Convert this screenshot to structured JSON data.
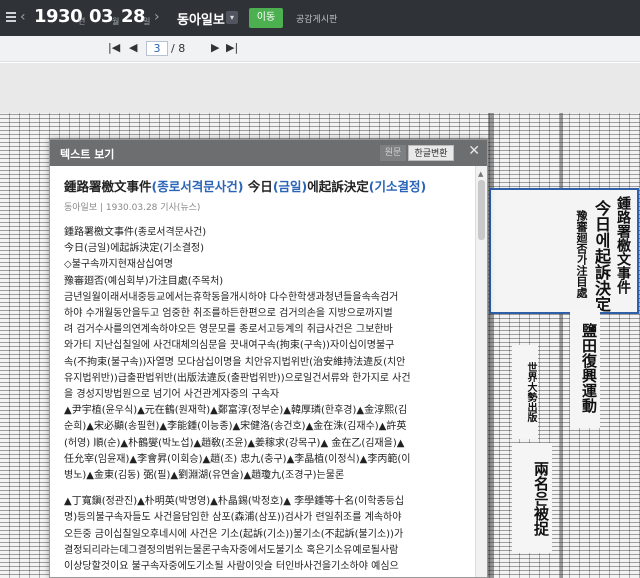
{
  "topbar": {
    "year": "1930",
    "year_unit": "년",
    "month": "03",
    "month_unit": "월",
    "day": "28",
    "day_unit": "일",
    "paper": "동아일보",
    "move_button": "이동",
    "public_board": "공감게시판"
  },
  "pager": {
    "current": "3",
    "total": "/ 8"
  },
  "viewer": {
    "title": "텍스트 보기",
    "tab_original": "원문",
    "tab_korean": "한글변환",
    "article_title_han": "鍾路署檄文事件",
    "article_title_ko": "(종로서격문사건)",
    "article_title_rest": " 今日",
    "article_title_ko2": "(금일)",
    "article_title_mid": "에起訴決定",
    "article_title_ko3": "(기소결정)",
    "meta": "동아일보 | 1930.03.28 기사(뉴스)",
    "lines": [
      "鍾路署檄文事件(종로서격문사건)",
      "今日(금일)에起訴決定(기소결정)",
      "◇불구속까지현재삼십여명",
      "豫審廻否(예심회부)가注目處(주목처)",
      "금년일월이래서내중등교에서는휴학동을개시하야 다수한학생과청년들을속속검거",
      "하야 수개월동안을두고 엄중한 취조를하든한편으로 검거의손을 지방으로까지벌",
      "려 검거수사를의연계속하야오든 영문모를 종로서고등계의 취급사건은 그보한바",
      "와가티 지난십칠일에 사건대체의심문을 끗내여구속(拘束(구속))자이십이명불구",
      "속(不拘束(불구속))자열명 모다삼십이명을 치안유지법위반(治安維持法違反(치안",
      "유지법위반))급출판법위반(出版法違反(출판법위반))으로일건서류와 한가지로 사건",
      "을 경성지방법원으로 넘기어 사건관계자중의 구속자",
      "▲尹宇植(윤우식)▲元在鶴(원재학)▲鄭富淳(정부순)▲韓厚璘(한후경)▲金淳熙(김",
      "순희)▲宋必顯(송필현)▲李能鍾(이능종)▲宋健洛(송건호)▲金在洙(김재수)▲許英",
      "(허영) 順(순)▲朴鶴燮(박노섭)▲趙敎(조윤)▲姜稼求(강목구)▲ 金在乙(김재을)▲",
      "任允宰(임윤재)▲李會昇(이회승)▲趙(조) 忠九(충구)▲李晶植(이정식)▲李丙範(이",
      "병노)▲金東(김동) 弼(필)▲劉淵湖(유연술)▲趙瓊九(조경구)는물론",
      "",
      "▲丁寬鎭(정관진)▲朴明英(박명영)▲朴晶錫(박정호)▲ 李學鍾等十名(이학종등십",
      "명)등의불구속자들도 사건을담임한 삼포(森浦(삼포))검사가 련일취조를 계속하야",
      "오든중 금이십칠일오후네시에 사건은 기소(起訴(기소))불기소(不起訴(불기소))가",
      "결정되리라는데그결정의범위는물론구속자중에서도불기소 혹은기소유예로될사람",
      "이상당할것이요 불구속자중에도기소될 사람이잇슬 터인바사건을기소하야 예심으"
    ],
    "newspaper_headline": "鍾路署檄文事件",
    "newspaper_sub1": "今日에起訴決定",
    "newspaper_sub2": "豫審廻否가注目處",
    "newspaper_box1": "鹽田復興運動",
    "newspaper_box2": "兩名은被捉",
    "newspaper_box3": "世界大勢出版"
  }
}
